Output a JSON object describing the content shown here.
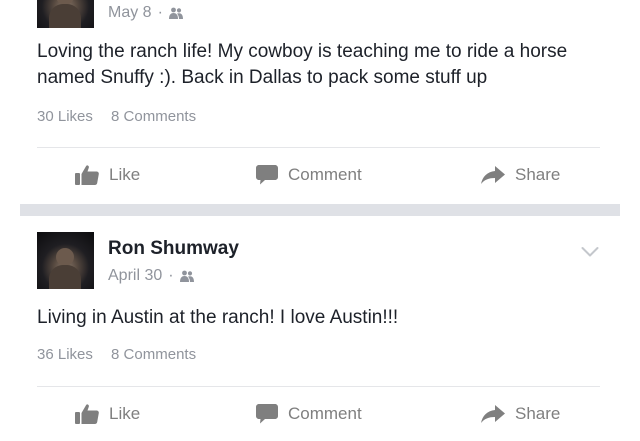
{
  "posts": [
    {
      "author": "",
      "date": "May 8",
      "separator": "·",
      "privacy_icon": "friends-icon",
      "text": "Loving the ranch life! My cowboy is teaching me to ride a horse named Snuffy :). Back in Dallas to pack some stuff up",
      "likes": "30 Likes",
      "comments": "8 Comments",
      "actions": {
        "like": "Like",
        "comment": "Comment",
        "share": "Share"
      }
    },
    {
      "author": "Ron Shumway",
      "date": "April 30",
      "separator": "·",
      "privacy_icon": "friends-icon",
      "text": "Living in Austin at the ranch! I love Austin!!!",
      "likes": "36 Likes",
      "comments": "8 Comments",
      "actions": {
        "like": "Like",
        "comment": "Comment",
        "share": "Share"
      }
    }
  ],
  "icons": {
    "like": "thumbs-up-icon",
    "comment": "speech-bubble-icon",
    "share": "share-arrow-icon",
    "menu": "chevron-down-icon"
  },
  "colors": {
    "text": "#1d2129",
    "secondary": "#90949c",
    "action": "#7f7f7f",
    "separator": "#dfe1e6"
  }
}
